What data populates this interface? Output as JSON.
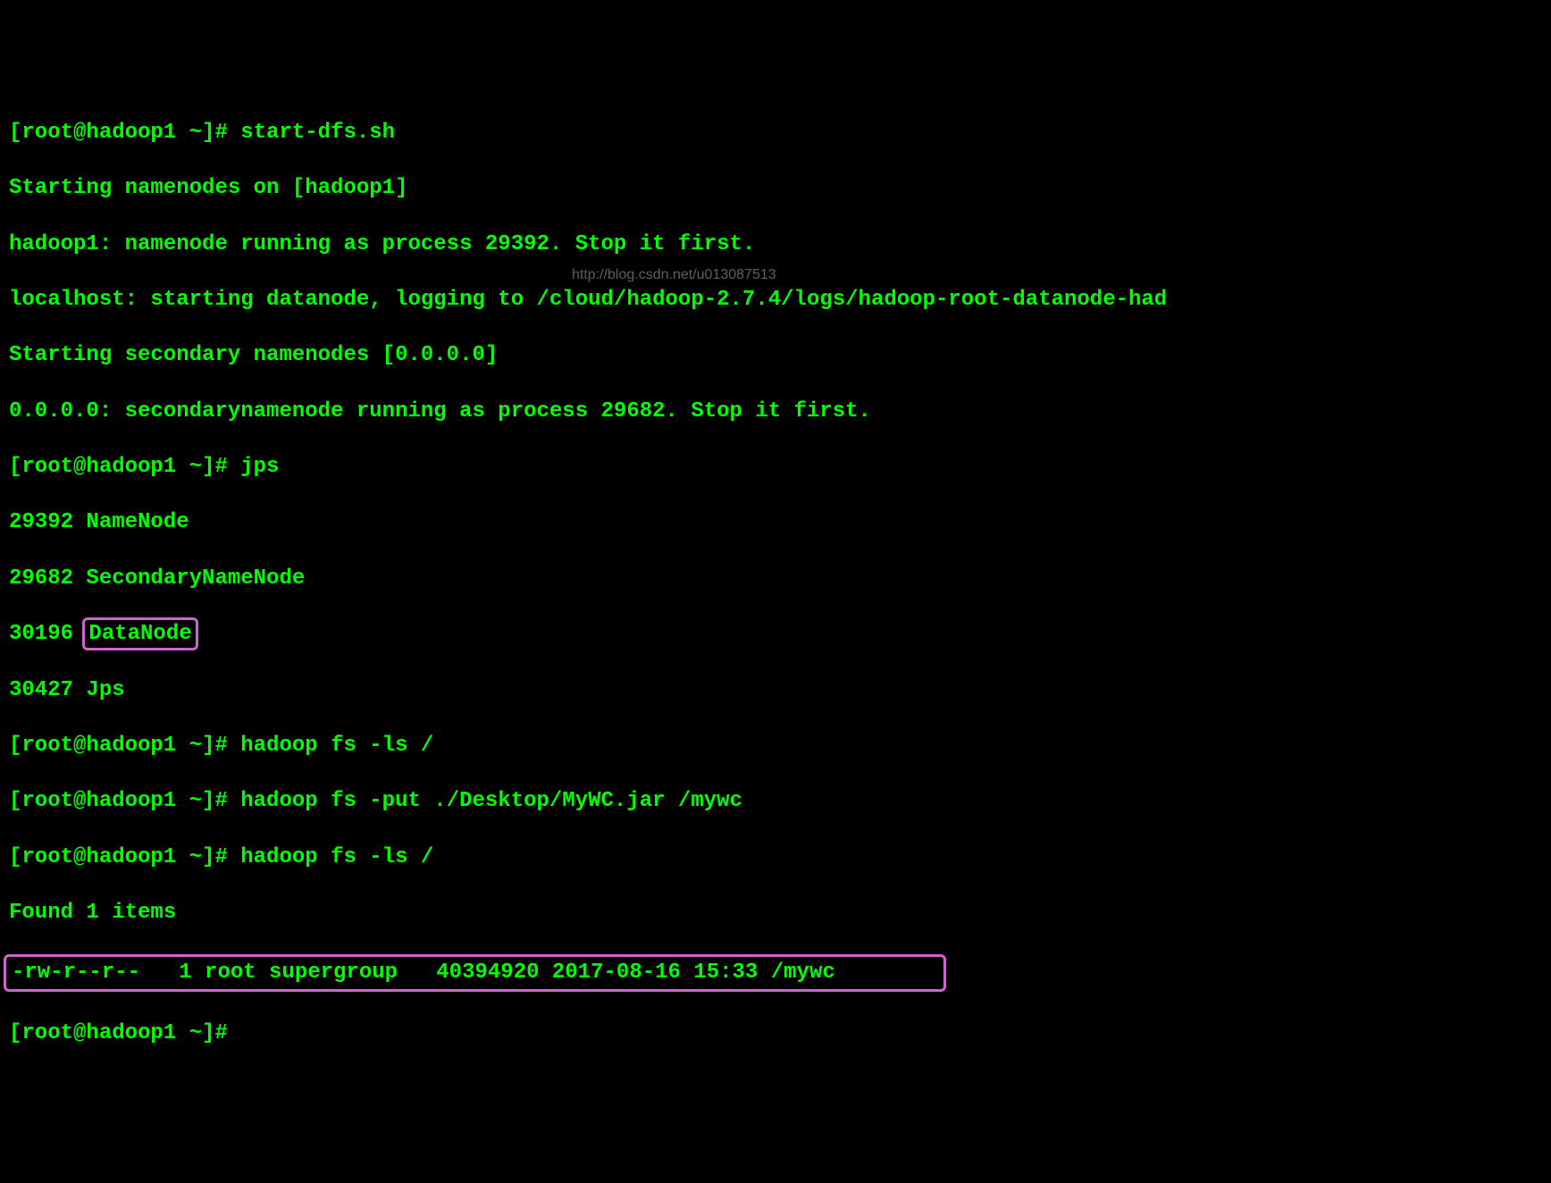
{
  "lines": {
    "l1_prompt": "[root@hadoop1 ~]# ",
    "l1_cmd": "start-dfs.sh",
    "l2": "Starting namenodes on [hadoop1]",
    "l3": "hadoop1: namenode running as process 29392. Stop it first.",
    "l4": "localhost: starting datanode, logging to /cloud/hadoop-2.7.4/logs/hadoop-root-datanode-had",
    "l5": "Starting secondary namenodes [0.0.0.0]",
    "l6": "0.0.0.0: secondarynamenode running as process 29682. Stop it first.",
    "l7_prompt": "[root@hadoop1 ~]# ",
    "l7_cmd": "jps",
    "l8": "29392 NameNode",
    "l9": "29682 SecondaryNameNode",
    "l10_pid": "30196 ",
    "l10_name": "DataNode",
    "l11": "30427 Jps",
    "l12_prompt": "[root@hadoop1 ~]# ",
    "l12_cmd": "hadoop fs -ls /",
    "l13_prompt": "[root@hadoop1 ~]# ",
    "l13_cmd": "hadoop fs -put ./Desktop/MyWC.jar /mywc",
    "l14_prompt": "[root@hadoop1 ~]# ",
    "l14_cmd": "hadoop fs -ls /",
    "l15": "Found 1 items",
    "l16": "-rw-r--r--   1 root supergroup   40394920 2017-08-16 15:33 /mywc",
    "l17_prompt": "[root@hadoop1 ~]#"
  },
  "watermark": "http://blog.csdn.net/u013087513"
}
